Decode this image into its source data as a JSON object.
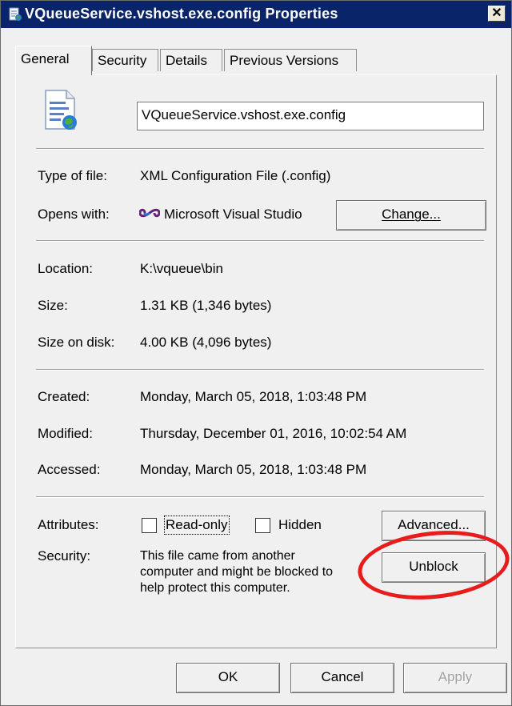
{
  "window": {
    "title": "VQueueService.vshost.exe.config Properties",
    "close_glyph": "✕"
  },
  "tabs": [
    {
      "label": "General",
      "active": true
    },
    {
      "label": "Security",
      "active": false
    },
    {
      "label": "Details",
      "active": false
    },
    {
      "label": "Previous Versions",
      "active": false
    }
  ],
  "file": {
    "name": "VQueueService.vshost.exe.config",
    "icon": "xml-config-file-icon"
  },
  "type_row": {
    "label": "Type of file:",
    "value": "XML Configuration File (.config)"
  },
  "opens_row": {
    "label": "Opens with:",
    "value": "Microsoft Visual Studio",
    "icon": "visual-studio-icon",
    "change_label": "Change..."
  },
  "location_row": {
    "label": "Location:",
    "value": "K:\\vqueue\\bin"
  },
  "size_row": {
    "label": "Size:",
    "value": "1.31 KB (1,346 bytes)"
  },
  "size_disk_row": {
    "label": "Size on disk:",
    "value": "4.00 KB (4,096 bytes)"
  },
  "created_row": {
    "label": "Created:",
    "value": "Monday, March 05, 2018, 1:03:48 PM"
  },
  "modified_row": {
    "label": "Modified:",
    "value": "Thursday, December 01, 2016, 10:02:54 AM"
  },
  "accessed_row": {
    "label": "Accessed:",
    "value": "Monday, March 05, 2018, 1:03:48 PM"
  },
  "attributes": {
    "label": "Attributes:",
    "readonly_label": "Read-only",
    "readonly_checked": false,
    "hidden_label": "Hidden",
    "hidden_checked": false,
    "advanced_label": "Advanced..."
  },
  "security": {
    "label": "Security:",
    "text": "This file came from another computer and might be blocked to help protect this computer.",
    "unblock_label": "Unblock",
    "highlight_color": "#e81c1c"
  },
  "buttons": {
    "ok": "OK",
    "cancel": "Cancel",
    "apply": "Apply"
  },
  "colors": {
    "titlebar": "#0a246a",
    "dialog": "#f0f0f0"
  }
}
